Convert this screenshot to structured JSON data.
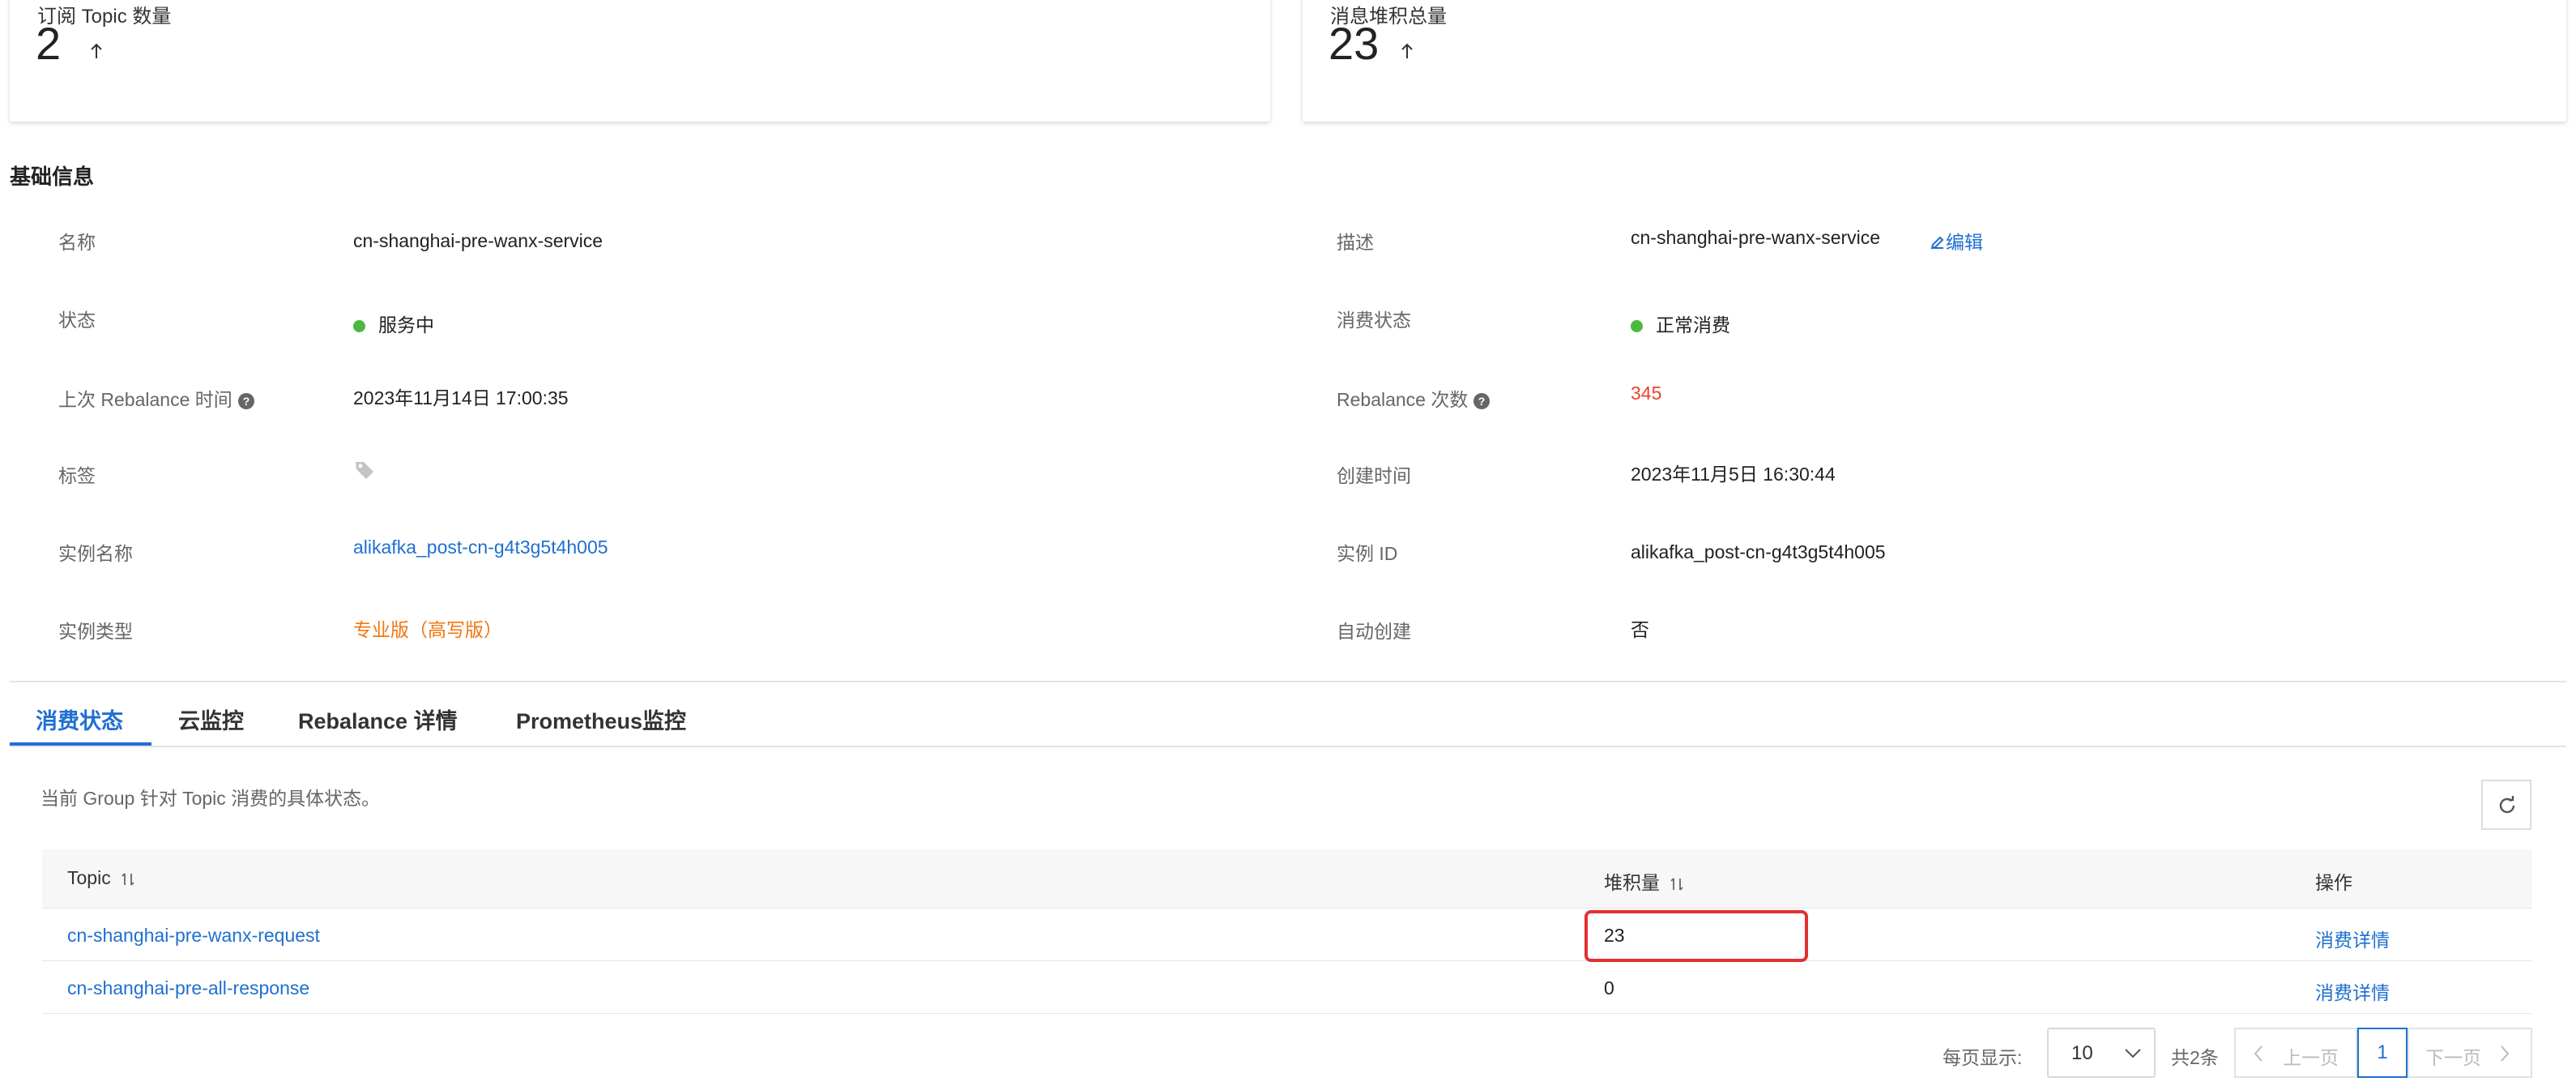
{
  "stats": [
    {
      "title": "订阅 Topic 数量",
      "value": "2",
      "icon": "arrow-up-icon"
    },
    {
      "title": "消息堆积总量",
      "value": "23",
      "icon": "arrow-up-icon"
    }
  ],
  "basic_info": {
    "title": "基础信息",
    "name_label": "名称",
    "name_value": "cn-shanghai-pre-wanx-service",
    "desc_label": "描述",
    "desc_value": "cn-shanghai-pre-wanx-service",
    "edit_label": "编辑",
    "status_label": "状态",
    "status_value": "服务中",
    "consume_status_label": "消费状态",
    "consume_status_value": "正常消费",
    "rebalance_time_label": "上次 Rebalance 时间",
    "rebalance_time_value": "2023年11月14日 17:00:35",
    "rebalance_count_label": "Rebalance 次数",
    "rebalance_count_value": "345",
    "tag_label": "标签",
    "created_label": "创建时间",
    "created_value": "2023年11月5日 16:30:44",
    "instance_name_label": "实例名称",
    "instance_name_value": "alikafka_post-cn-g4t3g5t4h005",
    "instance_id_label": "实例 ID",
    "instance_id_value": "alikafka_post-cn-g4t3g5t4h005",
    "instance_type_label": "实例类型",
    "instance_type_value": "专业版（高写版）",
    "auto_create_label": "自动创建",
    "auto_create_value": "否"
  },
  "tabs": [
    {
      "label": "消费状态",
      "active": true
    },
    {
      "label": "云监控",
      "active": false
    },
    {
      "label": "Rebalance 详情",
      "active": false
    },
    {
      "label": "Prometheus监控",
      "active": false
    }
  ],
  "consume": {
    "description": "当前 Group 针对 Topic 消费的具体状态。",
    "columns": {
      "topic": "Topic",
      "backlog": "堆积量",
      "actions": "操作"
    },
    "rows": [
      {
        "topic": "cn-shanghai-pre-wanx-request",
        "backlog": "23",
        "action": "消费详情"
      },
      {
        "topic": "cn-shanghai-pre-all-response",
        "backlog": "0",
        "action": "消费详情"
      }
    ]
  },
  "pagination": {
    "page_size_label": "每页显示:",
    "page_size": "10",
    "total": "共2条",
    "prev": "上一页",
    "current": "1",
    "next": "下一页"
  },
  "colors": {
    "accent": "#1f6fd1",
    "success": "#4cb83f",
    "danger": "#e8412f",
    "warning": "#f0760e",
    "highlight_border": "#e13030"
  }
}
